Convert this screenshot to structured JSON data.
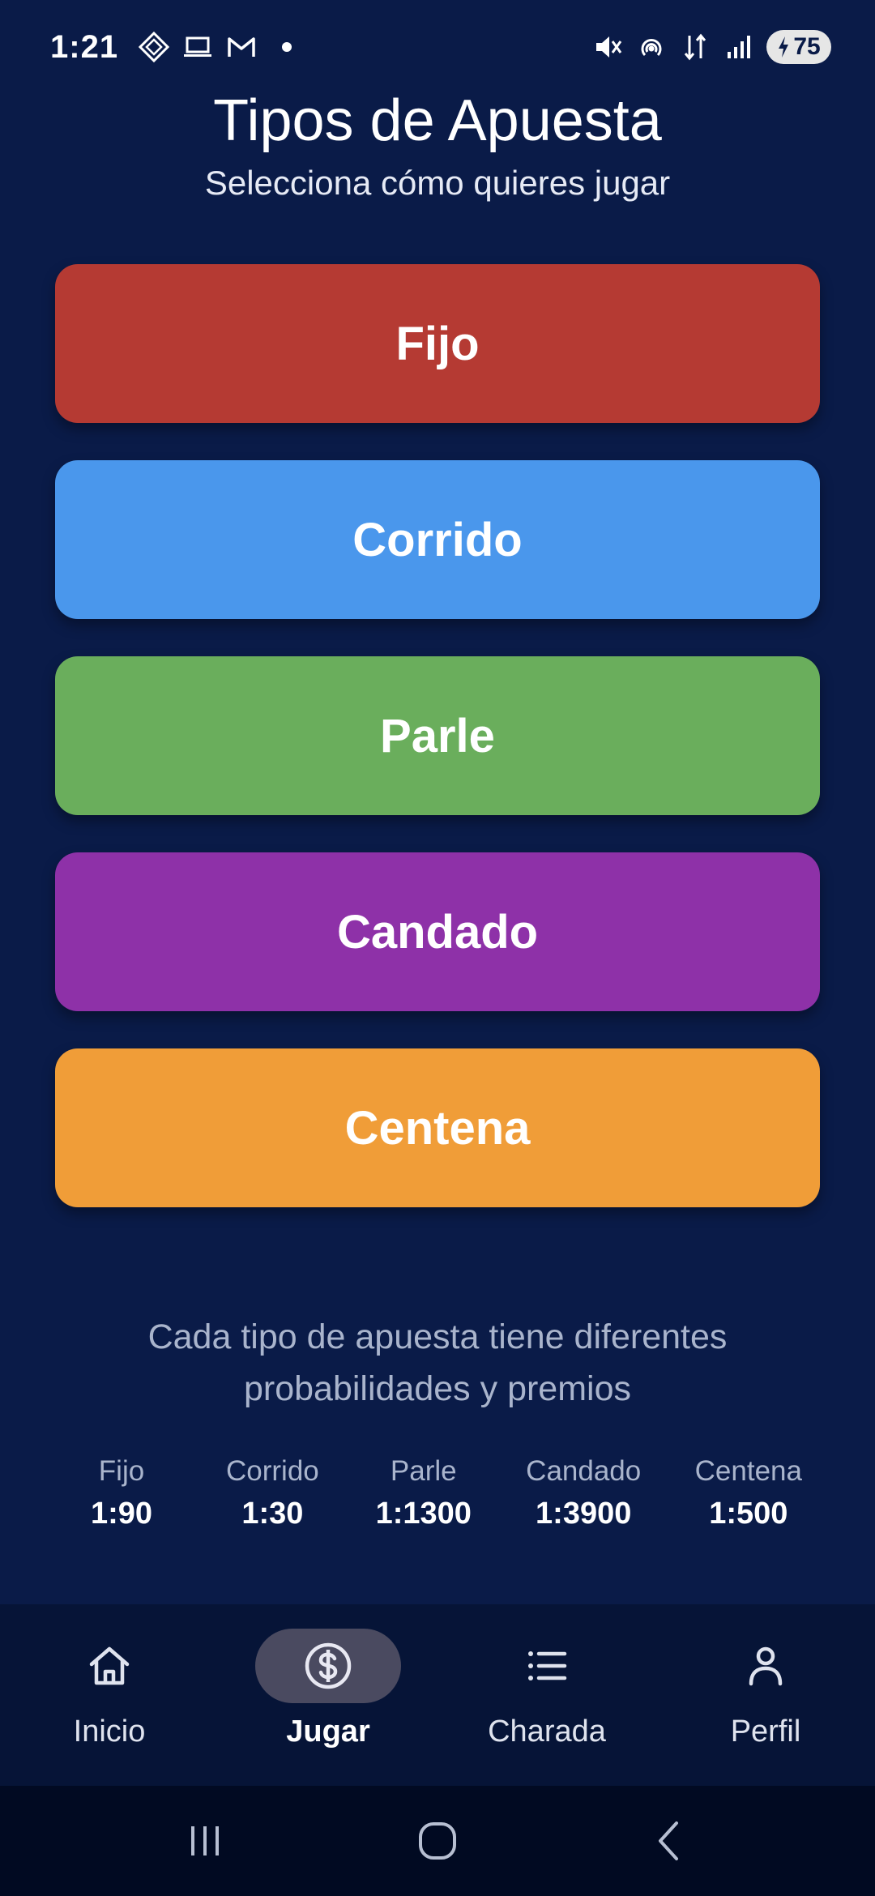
{
  "status_bar": {
    "time": "1:21",
    "battery": "75",
    "left_icons": [
      "diamond-icon",
      "laptop-icon",
      "gmail-icon",
      "notification-dot"
    ],
    "right_icons": [
      "mute-icon",
      "hotspot-icon",
      "data-arrows-icon",
      "signal-icon",
      "battery-icon"
    ]
  },
  "header": {
    "title": "Tipos de Apuesta",
    "subtitle": "Selecciona cómo quieres jugar"
  },
  "bet_types": [
    {
      "label": "Fijo",
      "color": "#b53a33"
    },
    {
      "label": "Corrido",
      "color": "#4a97ec"
    },
    {
      "label": "Parle",
      "color": "#6aae5c"
    },
    {
      "label": "Candado",
      "color": "#8e31a8"
    },
    {
      "label": "Centena",
      "color": "#f09d38"
    }
  ],
  "info": {
    "line1": "Cada tipo de apuesta tiene diferentes",
    "line2": "probabilidades y premios"
  },
  "odds": [
    {
      "name": "Fijo",
      "value": "1:90"
    },
    {
      "name": "Corrido",
      "value": "1:30"
    },
    {
      "name": "Parle",
      "value": "1:1300"
    },
    {
      "name": "Candado",
      "value": "1:3900"
    },
    {
      "name": "Centena",
      "value": "1:500"
    }
  ],
  "bottom_nav": {
    "items": [
      {
        "label": "Inicio",
        "icon": "home-icon",
        "active": false
      },
      {
        "label": "Jugar",
        "icon": "dollar-icon",
        "active": true
      },
      {
        "label": "Charada",
        "icon": "list-icon",
        "active": false
      },
      {
        "label": "Perfil",
        "icon": "person-icon",
        "active": false
      }
    ]
  },
  "colors": {
    "background": "#0a1b48",
    "nav_background": "#061437",
    "system_nav_background": "#010a22",
    "active_pill": "#4a4a60"
  }
}
